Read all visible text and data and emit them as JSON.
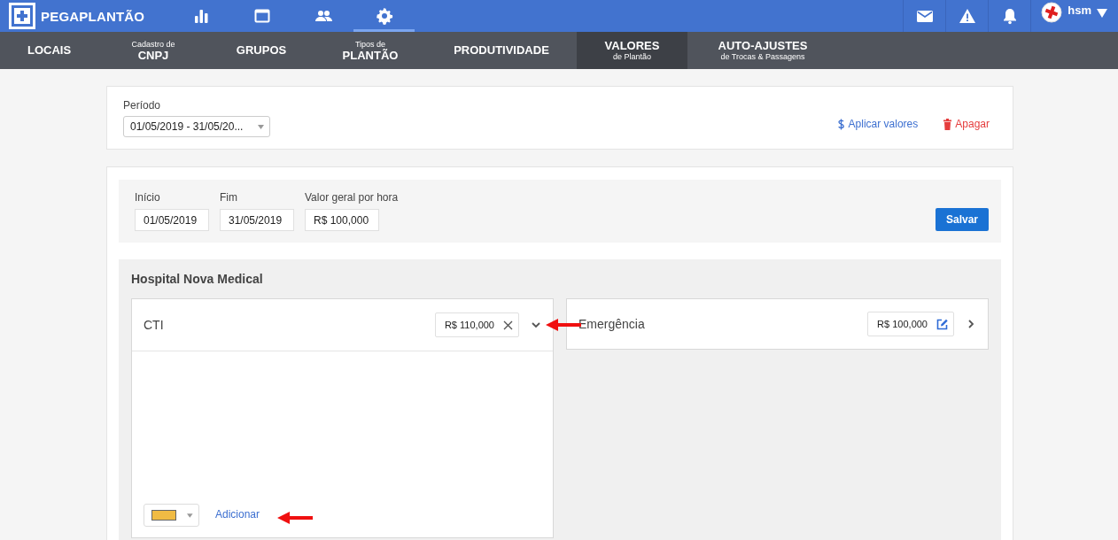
{
  "brand": {
    "name": "PEGAPLANTÃO"
  },
  "nav": [
    {
      "kind": "stats",
      "selected": false
    },
    {
      "kind": "calendar",
      "selected": false
    },
    {
      "kind": "people",
      "selected": false
    },
    {
      "kind": "settings",
      "selected": true
    }
  ],
  "header_actions": [
    {
      "kind": "mail"
    },
    {
      "kind": "warning"
    },
    {
      "kind": "bell"
    }
  ],
  "user": {
    "name": "hsm"
  },
  "subnav": [
    {
      "label": "LOCAIS",
      "selected": false
    },
    {
      "caption_above": "Cadastro de",
      "label": "CNPJ",
      "selected": false
    },
    {
      "label": "GRUPOS",
      "selected": false
    },
    {
      "caption_above": "Tipos de",
      "label": "PLANTÃO",
      "selected": false
    },
    {
      "label": "PRODUTIVIDADE",
      "selected": false
    },
    {
      "label": "VALORES",
      "caption_below": "de Plantão",
      "selected": true
    },
    {
      "label": "AUTO-AJUSTES",
      "caption_below": "de Trocas & Passagens",
      "selected": false
    }
  ],
  "period": {
    "label": "Período",
    "value": "01/05/2019 - 31/05/20...",
    "apply_link": "Aplicar valores",
    "delete_link": "Apagar"
  },
  "form": {
    "fields": [
      {
        "label": "Início",
        "value": "01/05/2019"
      },
      {
        "label": "Fim",
        "value": "31/05/2019"
      },
      {
        "label": "Valor geral por hora",
        "value": "R$ 100,000"
      }
    ],
    "save_button": "Salvar"
  },
  "hospital": {
    "name": "Hospital Nova Medical",
    "sectors": [
      {
        "name": "CTI",
        "value": "R$ 110,000",
        "expanded": true,
        "editing": true,
        "color_select": {
          "color": "#f0bb44"
        },
        "add_link": "Adicionar"
      },
      {
        "name": "Emergência",
        "value": "R$ 100,000",
        "expanded": false,
        "editing": false
      }
    ]
  },
  "annotations": [
    {
      "kind": "arrow"
    },
    {
      "kind": "arrow"
    }
  ]
}
